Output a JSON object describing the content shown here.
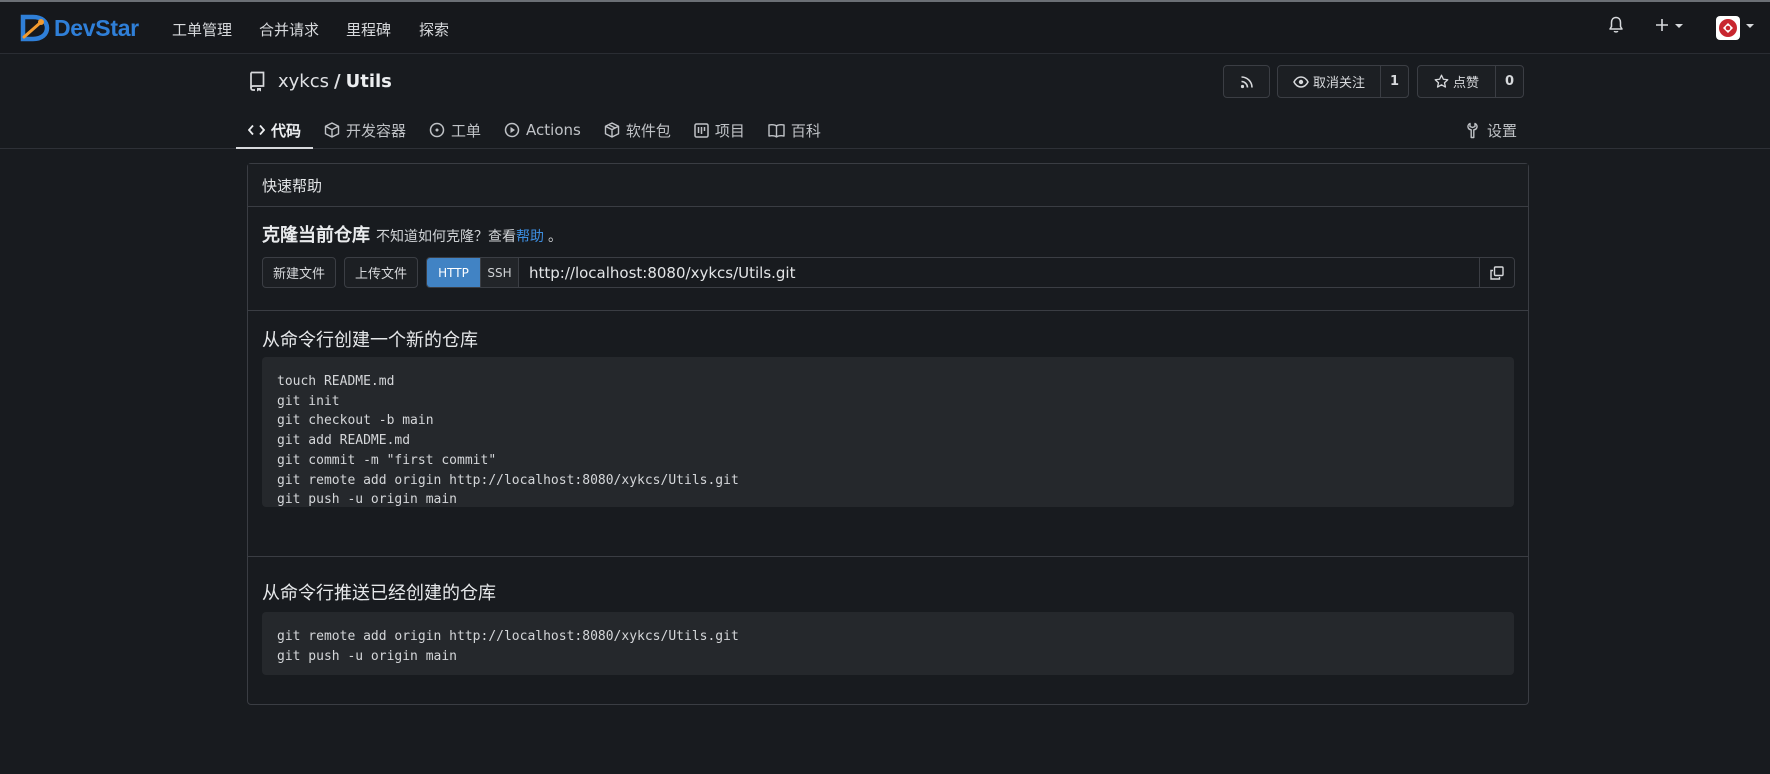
{
  "nav": {
    "brand": "DevStar",
    "items": [
      "工单管理",
      "合并请求",
      "里程碑",
      "探索"
    ]
  },
  "repo": {
    "owner": "xykcs",
    "name": "Utils",
    "unwatch_label": "取消关注",
    "watch_count": "1",
    "star_label": "点赞",
    "star_count": "0"
  },
  "tabs": [
    {
      "label": "代码",
      "icon": "code-icon"
    },
    {
      "label": "开发容器",
      "icon": "box-icon"
    },
    {
      "label": "工单",
      "icon": "issue-icon"
    },
    {
      "label": "Actions",
      "icon": "play-icon"
    },
    {
      "label": "软件包",
      "icon": "package-icon"
    },
    {
      "label": "项目",
      "icon": "project-icon"
    },
    {
      "label": "百科",
      "icon": "book-icon"
    }
  ],
  "settings_label": "设置",
  "panel": {
    "header": "快速帮助",
    "clone": {
      "title": "克隆当前仓库",
      "hint": "不知道如何克隆？查看",
      "help_link": "帮助",
      "end": "。",
      "new_file": "新建文件",
      "upload_file": "上传文件",
      "http": "HTTP",
      "ssh": "SSH",
      "url": "http://localhost:8080/xykcs/Utils.git"
    },
    "new_repo": {
      "title": "从命令行创建一个新的仓库",
      "code": "touch README.md\ngit init\ngit checkout -b main\ngit add README.md\ngit commit -m \"first commit\"\ngit remote add origin http://localhost:8080/xykcs/Utils.git\ngit push -u origin main"
    },
    "push_existing": {
      "title": "从命令行推送已经创建的仓库",
      "code": "git remote add origin http://localhost:8080/xykcs/Utils.git\ngit push -u origin main"
    }
  },
  "colors": {
    "accent": "#4183c4",
    "link": "#3d8ee0",
    "background": "#181b1f"
  }
}
